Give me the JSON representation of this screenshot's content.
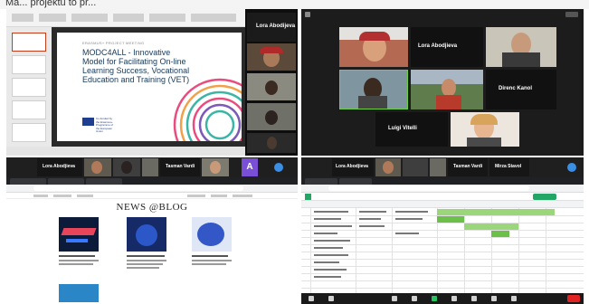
{
  "top_crop_text": "Ma... projektu to pr...",
  "q1": {
    "slide": {
      "kicker": "ERASMUS+ PROJECT MEETING",
      "title": "MODC4ALL - Innovative Model for Facilitating On-line Learning Success, Vocational Education and Training (VET)",
      "eu_text": "Co-funded by the Erasmus+ Programme of the European Union"
    },
    "participants": [
      {
        "name": "Lora Abodijeva"
      }
    ]
  },
  "q2": {
    "participants": [
      {
        "name": "Lora Abodjieva"
      },
      {
        "name": "Direnc Kanol"
      },
      {
        "name": "Luigi Vitelli"
      }
    ]
  },
  "q3": {
    "strip": [
      {
        "name": "Lora Abodjieva"
      },
      {
        "name": "Tasman Vardi"
      }
    ],
    "avatar_letter": "A",
    "page_title": "NEWS @BLOG"
  },
  "q4": {
    "strip": [
      {
        "name": "Lora Abodjieva"
      },
      {
        "name": "Tasman Vardi"
      },
      {
        "name": "Mirza Stavol"
      }
    ]
  },
  "colors": {
    "slide_title": "#17385a",
    "zoom_blue": "#3a8ee6",
    "sheet_green": "#9bd67a",
    "end_red": "#e02424"
  }
}
